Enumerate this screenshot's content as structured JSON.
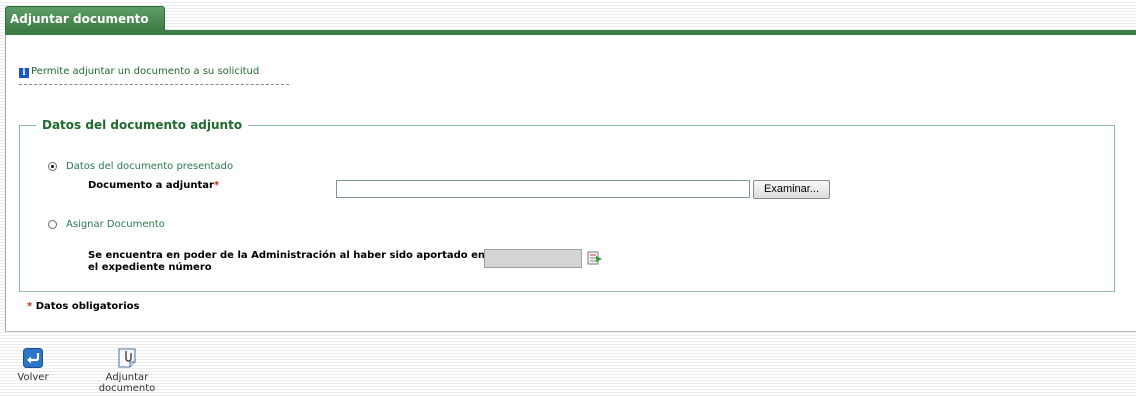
{
  "tab": {
    "title": "Adjuntar documento"
  },
  "info": {
    "icon": "info-icon",
    "text": "Permite adjuntar un documento a su solicitud"
  },
  "fieldset": {
    "legend": "Datos del documento adjunto",
    "option1": {
      "label": "Datos del documento presentado",
      "selected": true
    },
    "file_field": {
      "label": "Documento a adjuntar",
      "required_mark": "*",
      "value": "",
      "browse_label": "Examinar..."
    },
    "option2": {
      "label": "Asignar Documento",
      "selected": false
    },
    "expediente": {
      "label_line1": "Se encuentra en poder de la Administración al haber sido aportado en",
      "label_line2": "el expediente número",
      "value": "",
      "icon": "lookup-icon"
    }
  },
  "mandatory_note": {
    "mark": "*",
    "text": "Datos obligatorios"
  },
  "actions": [
    {
      "icon": "back-icon",
      "label": "Volver"
    },
    {
      "icon": "attach-document-icon",
      "label_line1": "Adjuntar",
      "label_line2": "documento"
    }
  ],
  "colors": {
    "accent": "#3f7d47",
    "label_green": "#2c7a4e",
    "info_blue": "#1b55c5",
    "required_red": "#c03020"
  }
}
